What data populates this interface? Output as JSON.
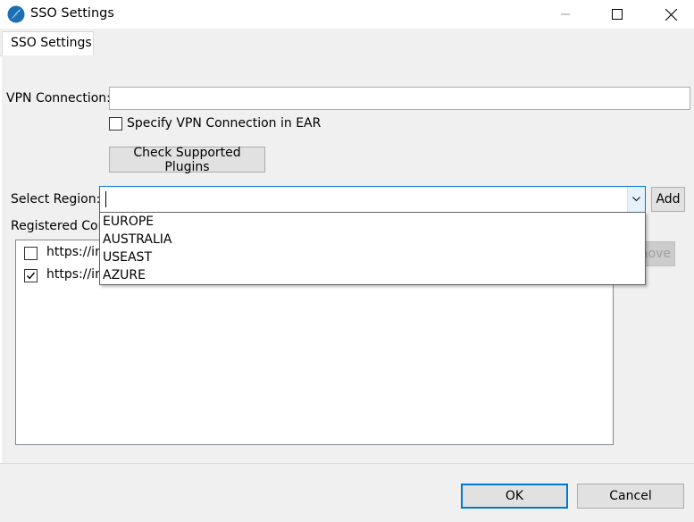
{
  "window": {
    "title": "SSO Settings",
    "icon": "app-feather-icon",
    "accent_color": "#0078d7"
  },
  "tabs": [
    {
      "label": "SSO Settings",
      "active": true
    }
  ],
  "form": {
    "vpn_label": "VPN Connection:",
    "vpn_value": "",
    "specify_vpn_label": "Specify VPN Connection in EAR",
    "specify_vpn_checked": false,
    "check_plugins_label": "Check Supported Plugins",
    "region_label": "Select Region:",
    "region_value": "",
    "add_label": "Add",
    "registered_label": "Registered Con",
    "remove_label": "move"
  },
  "region_options": [
    "EUROPE",
    "AUSTRALIA",
    "USEAST",
    "AZURE"
  ],
  "registered_items": [
    {
      "url": "https://in",
      "checked": false
    },
    {
      "url": "https://in",
      "checked": true
    }
  ],
  "footer": {
    "ok_label": "OK",
    "cancel_label": "Cancel"
  }
}
